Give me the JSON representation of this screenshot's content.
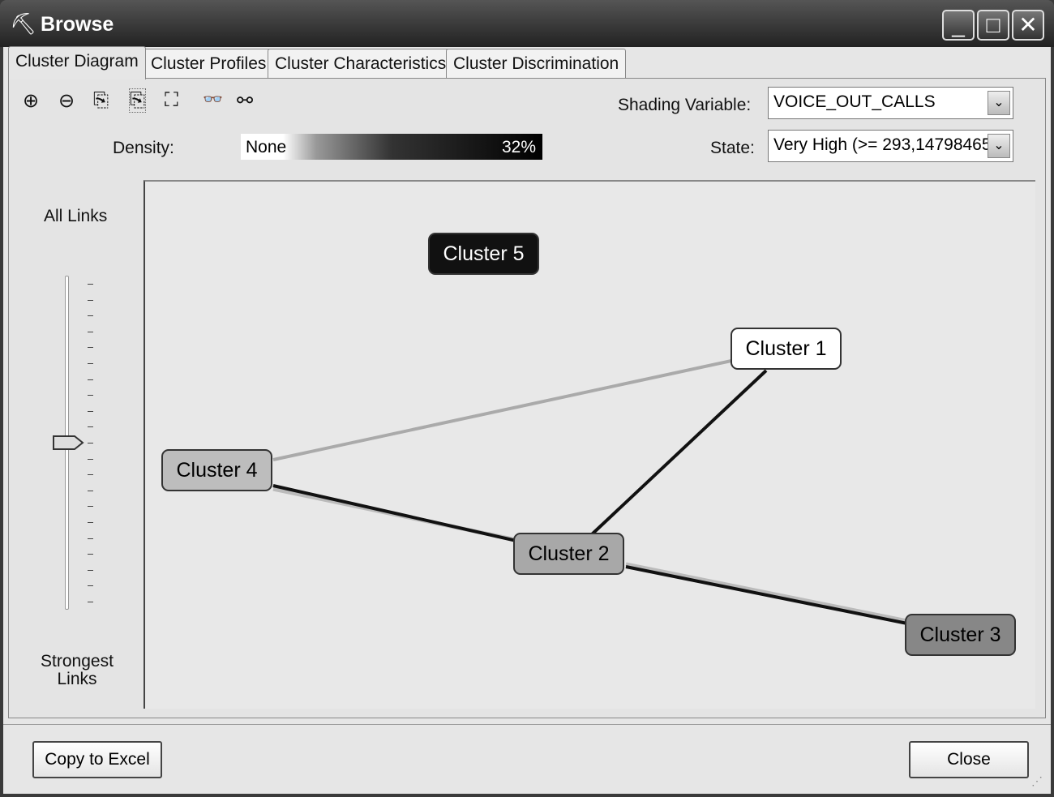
{
  "window": {
    "title": "Browse",
    "app_icon": "pickaxe-icon"
  },
  "tabs": [
    {
      "label": "Cluster Diagram",
      "active": true
    },
    {
      "label": "Cluster Profiles"
    },
    {
      "label": "Cluster Characteristics"
    },
    {
      "label": "Cluster Discrimination"
    }
  ],
  "toolbar": [
    "zoom-in-icon",
    "zoom-out-icon",
    "copy-icon",
    "copy-selection-icon",
    "fit-to-window-icon",
    "find-icon",
    "layout-icon"
  ],
  "density": {
    "label": "Density:",
    "min": "None",
    "max": "32%"
  },
  "shading": {
    "label": "Shading Variable:",
    "value": "VOICE_OUT_CALLS"
  },
  "state": {
    "label": "State:",
    "value": "Very High (>= 293,14798465"
  },
  "slider": {
    "top_label": "All Links",
    "bottom_label": "Strongest Links",
    "position_fraction": 0.5
  },
  "nodes": [
    {
      "id": "c5",
      "label": "Cluster 5",
      "fill": "#111111",
      "text": "#ffffff"
    },
    {
      "id": "c1",
      "label": "Cluster 1",
      "fill": "#ffffff",
      "text": "#000000"
    },
    {
      "id": "c4",
      "label": "Cluster 4",
      "fill": "#bdbdbd",
      "text": "#000000"
    },
    {
      "id": "c2",
      "label": "Cluster 2",
      "fill": "#a8a8a8",
      "text": "#000000"
    },
    {
      "id": "c3",
      "label": "Cluster 3",
      "fill": "#878787",
      "text": "#000000"
    }
  ],
  "links": [
    {
      "from": "c4",
      "to": "c1",
      "strength": "weak"
    },
    {
      "from": "c4",
      "to": "c2",
      "strength": "strong"
    },
    {
      "from": "c1",
      "to": "c2",
      "strength": "strong"
    },
    {
      "from": "c2",
      "to": "c3",
      "strength": "strong"
    }
  ],
  "buttons": {
    "copy_to_excel": "Copy to Excel",
    "close": "Close"
  }
}
